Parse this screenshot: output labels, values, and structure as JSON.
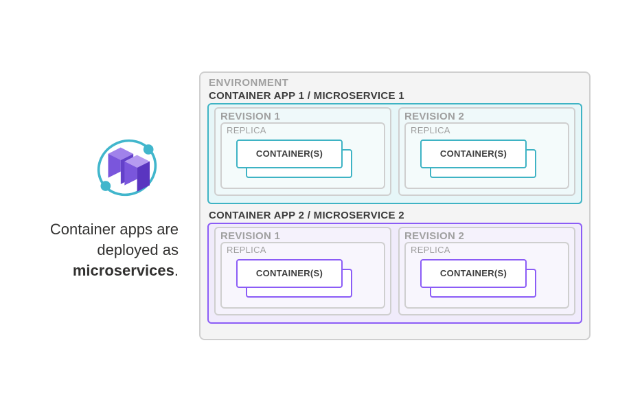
{
  "caption": {
    "line1": "Container apps are",
    "line2": "deployed as",
    "bold": "microservices",
    "suffix": "."
  },
  "environment": {
    "label": "ENVIRONMENT",
    "apps": [
      {
        "label": "CONTAINER APP 1 / MICROSERVICE 1",
        "color": "teal",
        "revisions": [
          {
            "label": "REVISION 1",
            "replica_label": "REPLICA",
            "container_label": "CONTAINER(S)"
          },
          {
            "label": "REVISION 2",
            "replica_label": "REPLICA",
            "container_label": "CONTAINER(S)"
          }
        ]
      },
      {
        "label": "CONTAINER APP 2 / MICROSERVICE 2",
        "color": "purple",
        "revisions": [
          {
            "label": "REVISION 1",
            "replica_label": "REPLICA",
            "container_label": "CONTAINER(S)"
          },
          {
            "label": "REVISION 2",
            "replica_label": "REPLICA",
            "container_label": "CONTAINER(S)"
          }
        ]
      }
    ]
  },
  "icon": {
    "name": "container-apps-service-icon",
    "colors": {
      "orbit": "#41b6cc",
      "cube_light": "#9b7fe5",
      "cube_dark": "#6f44d6"
    }
  }
}
